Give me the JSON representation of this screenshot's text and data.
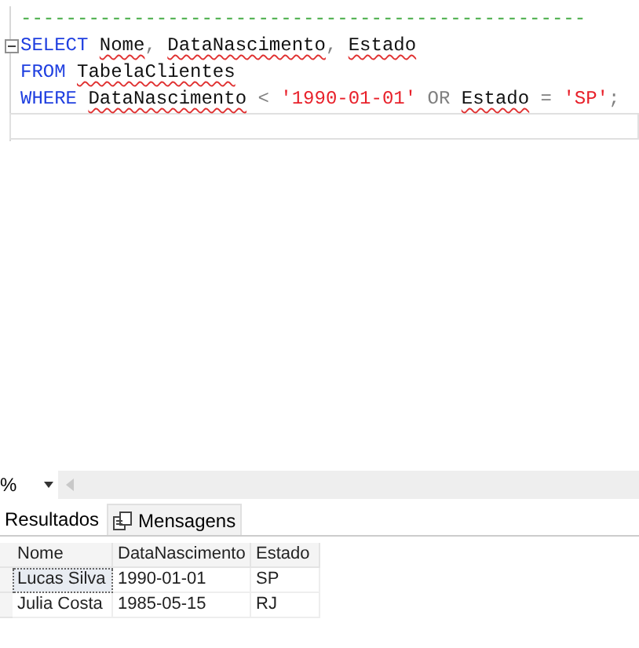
{
  "editor": {
    "lines": [
      {
        "collapse": false,
        "tokens": [
          {
            "kind": "comment",
            "text": "--------------------------------------------------"
          }
        ]
      },
      {
        "collapse": true,
        "tokens": [
          {
            "kind": "keyword",
            "text": "SELECT"
          },
          {
            "kind": "ident",
            "text": "Nome"
          },
          {
            "kind": "punct",
            "text": ", "
          },
          {
            "kind": "ident",
            "text": "DataNascimento"
          },
          {
            "kind": "punct",
            "text": ", "
          },
          {
            "kind": "ident",
            "text": "Estado"
          }
        ]
      },
      {
        "collapse": false,
        "tokens": [
          {
            "kind": "keyword",
            "text": "FROM"
          },
          {
            "kind": "ident",
            "text": "TabelaClientes"
          }
        ]
      },
      {
        "collapse": false,
        "tokens": [
          {
            "kind": "keyword",
            "text": "WHERE"
          },
          {
            "kind": "ident",
            "text": "DataNascimento"
          },
          {
            "kind": "punct",
            "text": " < "
          },
          {
            "kind": "string",
            "text": "'1990-01-01'"
          },
          {
            "kind": "punct",
            "text": " OR "
          },
          {
            "kind": "ident",
            "text": "Estado"
          },
          {
            "kind": "punct",
            "text": " = "
          },
          {
            "kind": "string",
            "text": "'SP'"
          },
          {
            "kind": "punct",
            "text": ";"
          }
        ]
      }
    ]
  },
  "zoom": {
    "value": "%"
  },
  "tabs": [
    {
      "label": "Resultados",
      "selected": true,
      "icon": false
    },
    {
      "label": "Mensagens",
      "selected": false,
      "icon": true
    }
  ],
  "table": {
    "columns": [
      "Nome",
      "DataNascimento",
      "Estado"
    ],
    "rows": [
      {
        "cells": [
          "Lucas Silva",
          "1990-01-01",
          "SP"
        ],
        "selected": true
      },
      {
        "cells": [
          "Julia Costa",
          "1985-05-15",
          "RJ"
        ],
        "selected": false
      }
    ]
  }
}
